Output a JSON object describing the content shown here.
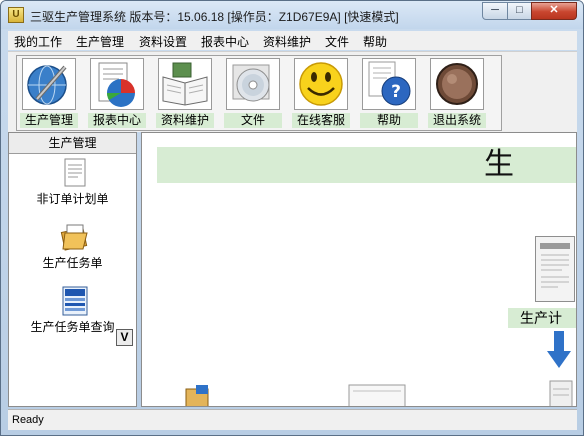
{
  "window": {
    "title": "三驱生产管理系统   版本号：15.06.18   [操作员：Z1D67E9A]  [快速模式]",
    "app_icon_glyph": "U",
    "minimize_glyph": "─",
    "maximize_glyph": "□",
    "close_glyph": "✕"
  },
  "menu": {
    "items": [
      "我的工作",
      "生产管理",
      "资料设置",
      "报表中心",
      "资料维护",
      "文件",
      "帮助"
    ]
  },
  "toolbar": {
    "items": [
      {
        "label": "生产管理",
        "icon": "globe-pen-icon"
      },
      {
        "label": "报表中心",
        "icon": "pie-chart-report-icon"
      },
      {
        "label": "资料维护",
        "icon": "open-book-icon"
      },
      {
        "label": "文件",
        "icon": "cd-disc-icon"
      },
      {
        "label": "在线客服",
        "icon": "smiley-face-icon"
      },
      {
        "label": "帮助",
        "icon": "help-question-icon"
      },
      {
        "label": "退出系统",
        "icon": "exit-circle-icon"
      }
    ]
  },
  "sidebar": {
    "header": "生产管理",
    "items": [
      {
        "label": "非订单计划单",
        "icon": "document-icon"
      },
      {
        "label": "生产任务单",
        "icon": "folder-task-icon"
      },
      {
        "label": "生产任务单查询",
        "icon": "query-report-icon"
      }
    ],
    "scroll_glyph": "V"
  },
  "main": {
    "banner_text": "生",
    "flow_label": "生产计"
  },
  "status": {
    "text": "Ready"
  },
  "colors": {
    "label_green": "#d7ecd3",
    "frame_blue": "#c9dbee",
    "close_red": "#c9462f"
  }
}
